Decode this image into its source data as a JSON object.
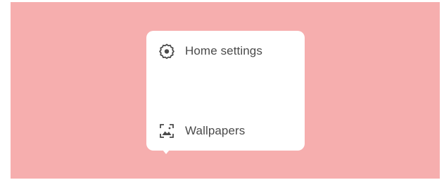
{
  "background_color": "#f6aeae",
  "popup": {
    "items": [
      {
        "icon": "gear-icon",
        "label": "Home settings"
      },
      {
        "icon": "wallpaper-icon",
        "label": "Wallpapers"
      }
    ]
  }
}
